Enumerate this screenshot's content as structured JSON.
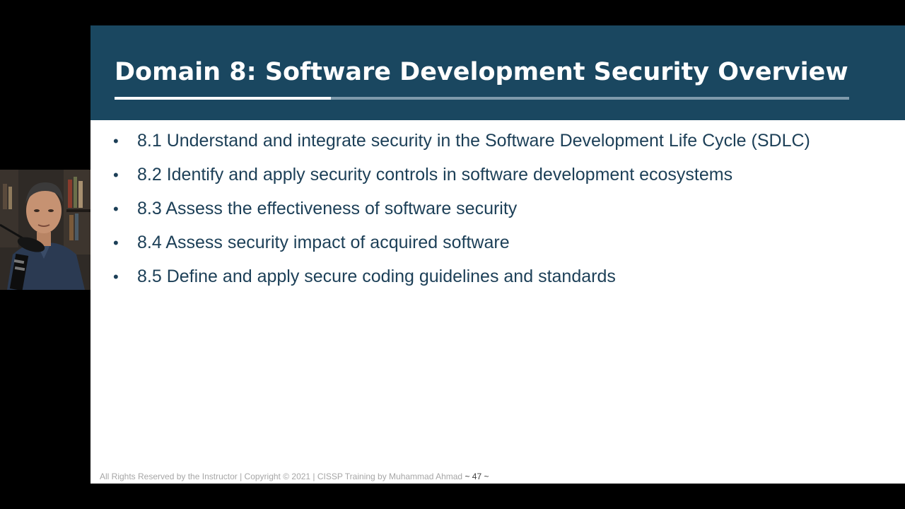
{
  "slide": {
    "title": "Domain 8: Software Development Security Overview",
    "bullets": [
      {
        "marker": "•",
        "text": "8.1 Understand and integrate security in the Software Development Life Cycle (SDLC)"
      },
      {
        "marker": "•",
        "text": "8.2 Identify and apply security controls in software development ecosystems"
      },
      {
        "marker": "•",
        "text": "8.3 Assess the effectiveness of software security"
      },
      {
        "marker": "•",
        "text": "8.4 Assess security impact of acquired software"
      },
      {
        "marker": "•",
        "text": "8.5 Define and apply secure coding guidelines and standards"
      }
    ],
    "footer": {
      "text": "All Rights Reserved by the Instructor | Copyright © 2021 | CISSP Training by Muhammad Ahmad",
      "page": "~ 47 ~"
    }
  },
  "colors": {
    "header_background": "#1a4760",
    "title_text": "#ffffff",
    "bullet_text": "#1c3f57",
    "footer_text": "#a6a6a6",
    "page_background": "#000000"
  },
  "webcam": {
    "icon": "presenter-webcam-icon"
  }
}
